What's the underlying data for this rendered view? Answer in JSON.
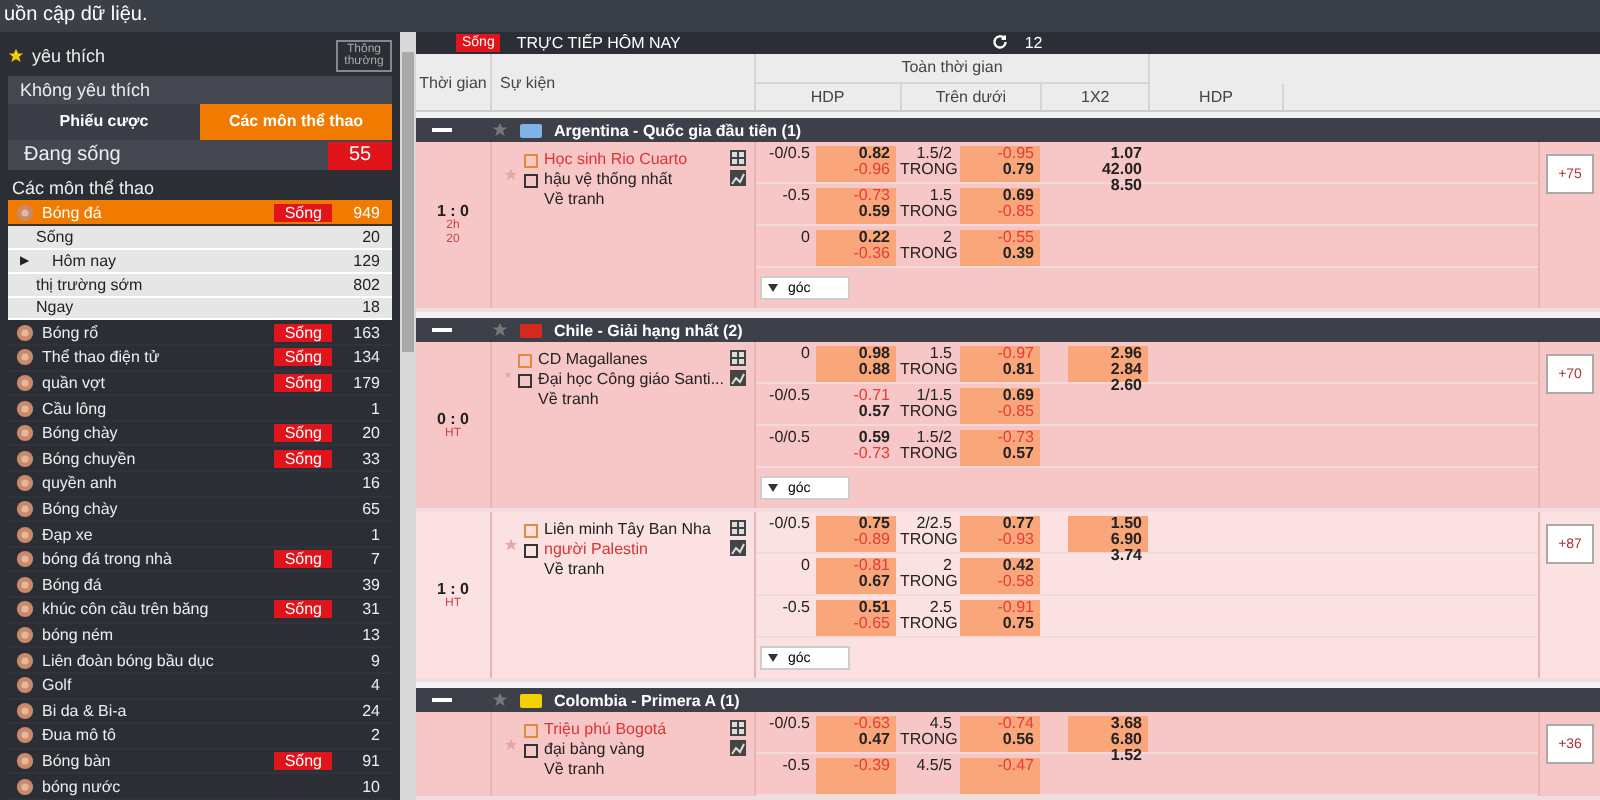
{
  "top_bar": "uồn cập dữ liệu.",
  "sidebar": {
    "favorites": "yêu thích",
    "mode_button": "Thông thường",
    "unfavorite": "Không yêu thích",
    "tabs": [
      {
        "label": "Phiếu cược",
        "selected": false
      },
      {
        "label": "Các môn thể thao",
        "selected": true
      }
    ],
    "live": {
      "label": "Đang sống",
      "count": "55"
    },
    "heading": "Các môn thể thao",
    "sports": [
      {
        "name": "Bóng đá",
        "live": "Sống",
        "count": "949",
        "selected": true,
        "children": [
          {
            "name": "Sống",
            "count": "20"
          },
          {
            "marker": "▶",
            "name": "Hôm nay",
            "count": "129"
          },
          {
            "name": "thị trường sớm",
            "count": "802"
          },
          {
            "name": "Ngay",
            "count": "18"
          }
        ]
      },
      {
        "name": "Bóng rổ",
        "live": "Sống",
        "count": "163",
        "selected": false
      },
      {
        "name": "Thể thao điện tử",
        "live": "Sống",
        "count": "134",
        "selected": false
      },
      {
        "name": "quần vợt",
        "live": "Sống",
        "count": "179",
        "selected": false
      },
      {
        "name": "Cầu lông",
        "count": "1",
        "selected": false
      },
      {
        "name": "Bóng chày",
        "live": "Sống",
        "count": "20",
        "selected": false
      },
      {
        "name": "Bóng chuyền",
        "live": "Sống",
        "count": "33",
        "selected": false
      },
      {
        "name": "quyền anh",
        "count": "16",
        "selected": false
      },
      {
        "name": "Bóng chày",
        "count": "65",
        "selected": false
      },
      {
        "name": "Đạp xe",
        "count": "1",
        "selected": false
      },
      {
        "name": "bóng đá trong nhà",
        "live": "Sống",
        "count": "7",
        "selected": false
      },
      {
        "name": "Bóng đá",
        "count": "39",
        "selected": false
      },
      {
        "name": "khúc côn cầu trên băng",
        "live": "Sống",
        "count": "31",
        "selected": false
      },
      {
        "name": "bóng ném",
        "count": "13",
        "selected": false
      },
      {
        "name": "Liên đoàn bóng bầu dục",
        "count": "9",
        "selected": false
      },
      {
        "name": "Golf",
        "count": "4",
        "selected": false
      },
      {
        "name": "Bi da & Bi-a",
        "count": "24",
        "selected": false
      },
      {
        "name": "Đua mô tô",
        "count": "2",
        "selected": false
      },
      {
        "name": "Bóng bàn",
        "live": "Sống",
        "count": "91",
        "selected": false
      },
      {
        "name": "bóng nước",
        "count": "10",
        "selected": false
      }
    ]
  },
  "header": {
    "badge": "Sống",
    "title": "TRỰC TIẾP HÔM NAY",
    "count": "12"
  },
  "columns": {
    "time": "Thời gian",
    "event": "Sự kiện",
    "group": "Toàn thời gian",
    "sub": [
      "HDP",
      "Trên dưới",
      "1X2",
      "HDP"
    ]
  },
  "leagues": [
    {
      "name": "Argentina - Quốc gia đầu tiên (1)",
      "color": "#7fb2e5",
      "matches": [
        {
          "score": "1 : 0",
          "status": [
            "2h",
            "20"
          ],
          "highlighted": true,
          "teams": [
            {
              "name": "Học sinh Rio Cuarto",
              "red": true
            },
            {
              "name": "hậu vệ thống nhất",
              "red": false
            }
          ],
          "draw": "Về tranh",
          "more": "+75",
          "corner": "góc",
          "x12": {
            "values": [
              "1.07",
              "42.00",
              "8.50"
            ],
            "highlight": false
          },
          "odds": [
            {
              "hdp": "-0/0.5",
              "home": "0.82",
              "away": "-0.96",
              "hdp_highlight": true,
              "ou": "1.5/2",
              "ou_label": "TRONG",
              "over": "-0.95",
              "under": "0.79",
              "ou_highlight": true
            },
            {
              "hdp": "-0.5",
              "home": "-0.73",
              "away": "0.59",
              "hdp_highlight": true,
              "ou": "1.5",
              "ou_label": "TRONG",
              "over": "0.69",
              "under": "-0.85",
              "ou_highlight": true
            },
            {
              "hdp": "0",
              "home": "0.22",
              "away": "-0.36",
              "hdp_highlight": true,
              "ou": "2",
              "ou_label": "TRONG",
              "over": "-0.55",
              "under": "0.39",
              "ou_highlight": true
            }
          ]
        }
      ]
    },
    {
      "name": "Chile - Giải hạng nhất (2)",
      "color": "#d52b1e",
      "matches": [
        {
          "score": "0 : 0",
          "status": [
            "HT"
          ],
          "highlighted": true,
          "teams": [
            {
              "name": "CD Magallanes",
              "red": false
            },
            {
              "name": "Đại học Công giáo Santi...",
              "red": false
            }
          ],
          "draw": "Về tranh",
          "more": "+70",
          "corner": "góc",
          "x12": {
            "values": [
              "2.96",
              "2.84",
              "2.60"
            ],
            "highlight": true
          },
          "odds": [
            {
              "hdp": "0",
              "home": "0.98",
              "away": "0.88",
              "hdp_highlight": true,
              "ou": "1.5",
              "ou_label": "TRONG",
              "over": "-0.97",
              "under": "0.81",
              "ou_highlight": true
            },
            {
              "hdp": "-0/0.5",
              "home": "-0.71",
              "away": "0.57",
              "hdp_highlight": false,
              "ou": "1/1.5",
              "ou_label": "TRONG",
              "over": "0.69",
              "under": "-0.85",
              "ou_highlight": true
            },
            {
              "hdp": "-0/0.5",
              "home": "0.59",
              "away": "-0.73",
              "hdp_highlight": false,
              "ou": "1.5/2",
              "ou_label": "TRONG",
              "over": "-0.73",
              "under": "0.57",
              "ou_highlight": true
            }
          ]
        },
        {
          "score": "1 : 0",
          "status": [
            "HT"
          ],
          "highlighted": false,
          "teams": [
            {
              "name": "Liên minh Tây Ban Nha",
              "red": false
            },
            {
              "name": "người Palestin",
              "red": true
            }
          ],
          "draw": "Về tranh",
          "more": "+87",
          "corner": "góc",
          "x12": {
            "values": [
              "1.50",
              "6.90",
              "3.74"
            ],
            "highlight": true
          },
          "odds": [
            {
              "hdp": "-0/0.5",
              "home": "0.75",
              "away": "-0.89",
              "hdp_highlight": true,
              "ou": "2/2.5",
              "ou_label": "TRONG",
              "over": "0.77",
              "under": "-0.93",
              "ou_highlight": true
            },
            {
              "hdp": "0",
              "home": "-0.81",
              "away": "0.67",
              "hdp_highlight": true,
              "ou": "2",
              "ou_label": "TRONG",
              "over": "0.42",
              "under": "-0.58",
              "ou_highlight": true
            },
            {
              "hdp": "-0.5",
              "home": "0.51",
              "away": "-0.65",
              "hdp_highlight": true,
              "ou": "2.5",
              "ou_label": "TRONG",
              "over": "-0.91",
              "under": "0.75",
              "ou_highlight": true
            }
          ]
        }
      ]
    },
    {
      "name": "Colombia - Primera A (1)",
      "color": "#f5d000",
      "matches": [
        {
          "highlighted": true,
          "teams": [
            {
              "name": "Triệu phú Bogotá",
              "red": true
            },
            {
              "name": "đại bàng vàng",
              "red": false
            }
          ],
          "draw": "Về tranh",
          "more": "+36",
          "x12": {
            "values": [
              "3.68",
              "6.80",
              "1.52"
            ],
            "highlight": true
          },
          "odds": [
            {
              "hdp": "-0/0.5",
              "home": "-0.63",
              "away": "0.47",
              "hdp_highlight": true,
              "ou": "4.5",
              "ou_label": "TRONG",
              "over": "-0.74",
              "under": "0.56",
              "ou_highlight": true
            },
            {
              "hdp": "-0.5",
              "home": "-0.39",
              "hdp_highlight": true,
              "ou": "4.5/5",
              "over": "-0.47",
              "ou_highlight": true
            }
          ]
        }
      ]
    }
  ]
}
